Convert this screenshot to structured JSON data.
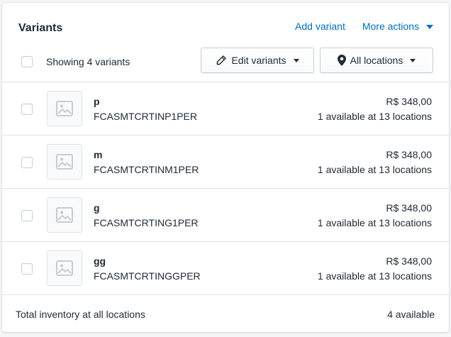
{
  "card": {
    "title": "Variants",
    "add_variant_label": "Add variant",
    "more_actions_label": "More actions",
    "showing_label": "Showing 4 variants",
    "edit_variants_label": "Edit variants",
    "locations_label": "All locations"
  },
  "variants": [
    {
      "name": "p",
      "sku": "FCASMTCRTINP1PER",
      "price": "R$ 348,00",
      "availability": "1 available at 13 locations"
    },
    {
      "name": "m",
      "sku": "FCASMTCRTINM1PER",
      "price": "R$ 348,00",
      "availability": "1 available at 13 locations"
    },
    {
      "name": "g",
      "sku": "FCASMTCRTING1PER",
      "price": "R$ 348,00",
      "availability": "1 available at 13 locations"
    },
    {
      "name": "gg",
      "sku": "FCASMTCRTINGGPER",
      "price": "R$ 348,00",
      "availability": "1 available at 13 locations"
    }
  ],
  "footer": {
    "total_label": "Total inventory at all locations",
    "total_value": "4 available"
  },
  "colors": {
    "link": "#006fbb",
    "border": "#dfe3e8",
    "text": "#212b36"
  },
  "icons": {
    "edit": "pencil-icon",
    "location": "location-pin-icon",
    "placeholder": "image-placeholder-icon"
  }
}
